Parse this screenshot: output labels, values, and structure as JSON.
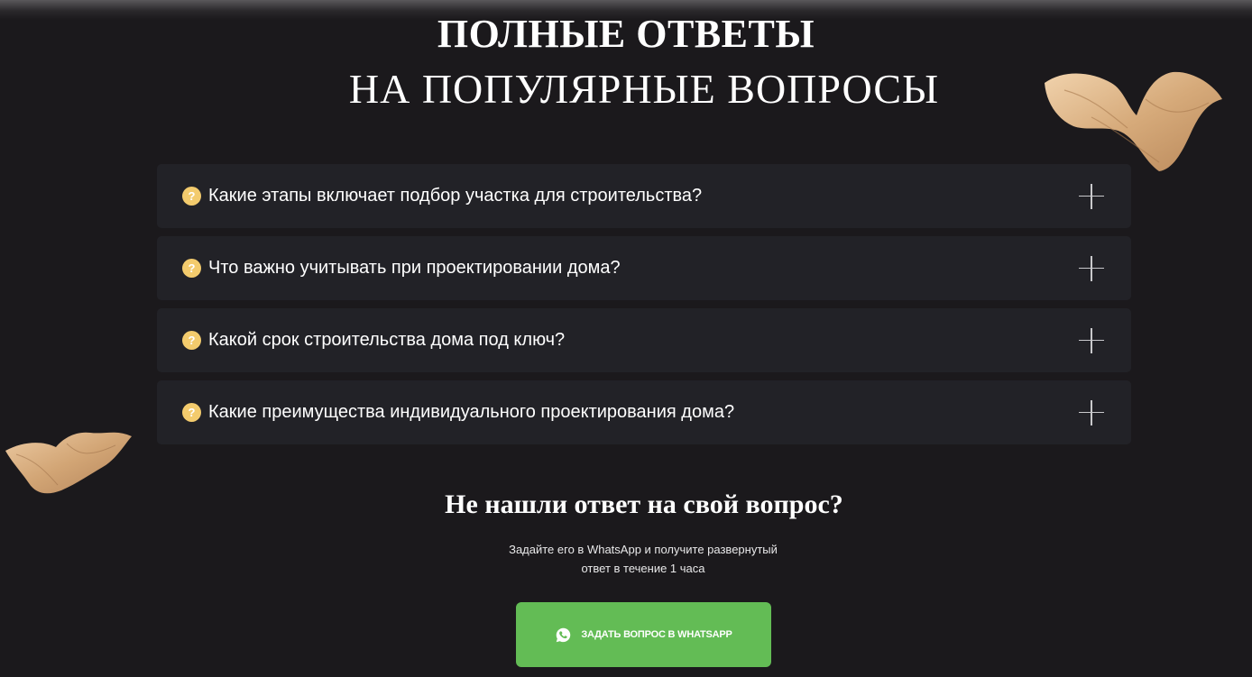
{
  "section": {
    "title_line1": "ПОЛНЫЕ ОТВЕТЫ",
    "title_line2": "НА ПОПУЛЯРНЫЕ ВОПРОСЫ"
  },
  "faq": {
    "icon_glyph": "?",
    "items": [
      {
        "question": "Какие этапы включает подбор участка для строительства?"
      },
      {
        "question": "Что важно учитывать при проектировании дома?"
      },
      {
        "question": "Какой срок строительства дома под ключ?"
      },
      {
        "question": "Какие преимущества индивидуального проектирования дома?"
      }
    ]
  },
  "cta": {
    "heading": "Не нашли ответ на свой вопрос?",
    "text_line1": "Задайте его в WhatsApp и получите развернутый",
    "text_line2": "ответ в течение 1 часа",
    "button_label": "ЗАДАТЬ ВОПРОС В WHATSAPP",
    "button_icon": "whatsapp-icon"
  },
  "colors": {
    "background": "#1b191c",
    "card": "#222227",
    "question_icon": "#f3cb6d",
    "button": "#63bc55",
    "decor_wood": "#d9b48a"
  }
}
